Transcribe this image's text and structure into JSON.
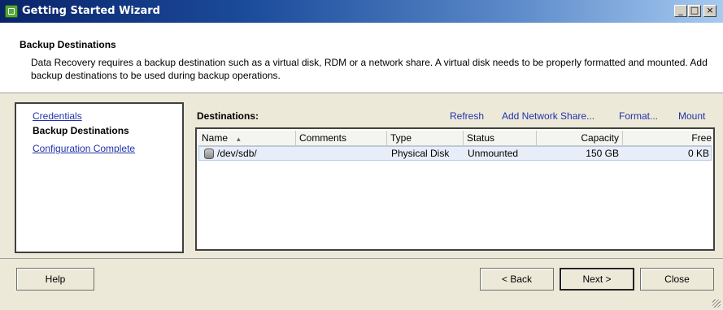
{
  "window": {
    "title": "Getting Started Wizard"
  },
  "header": {
    "title": "Backup Destinations",
    "description": "Data Recovery requires a backup destination such as a virtual disk, RDM or a network share. A virtual disk needs to be properly formatted and mounted.  Add backup destinations to be used during backup operations."
  },
  "nav": {
    "items": [
      {
        "label": "Credentials"
      },
      {
        "label": "Backup Destinations"
      },
      {
        "label": "Configuration Complete"
      }
    ]
  },
  "destinations": {
    "label": "Destinations:",
    "actions": {
      "refresh": "Refresh",
      "add_share": "Add Network Share...",
      "format": "Format...",
      "mount": "Mount"
    },
    "columns": [
      "Name",
      "Comments",
      "Type",
      "Status",
      "Capacity",
      "Free"
    ],
    "rows": [
      {
        "name": "/dev/sdb/",
        "comments": "",
        "type": "Physical Disk",
        "status": "Unmounted",
        "capacity": "150 GB",
        "free": "0 KB"
      }
    ]
  },
  "buttons": {
    "help": "Help",
    "back": "< Back",
    "next": "Next >",
    "close": "Close"
  },
  "colors": {
    "accent": "#0a246a",
    "link": "#2233aa",
    "selection": "#e7eef8"
  },
  "icons": {
    "app": "wizard-icon",
    "disk": "disk-icon",
    "sort": "sort-ascending-icon"
  }
}
